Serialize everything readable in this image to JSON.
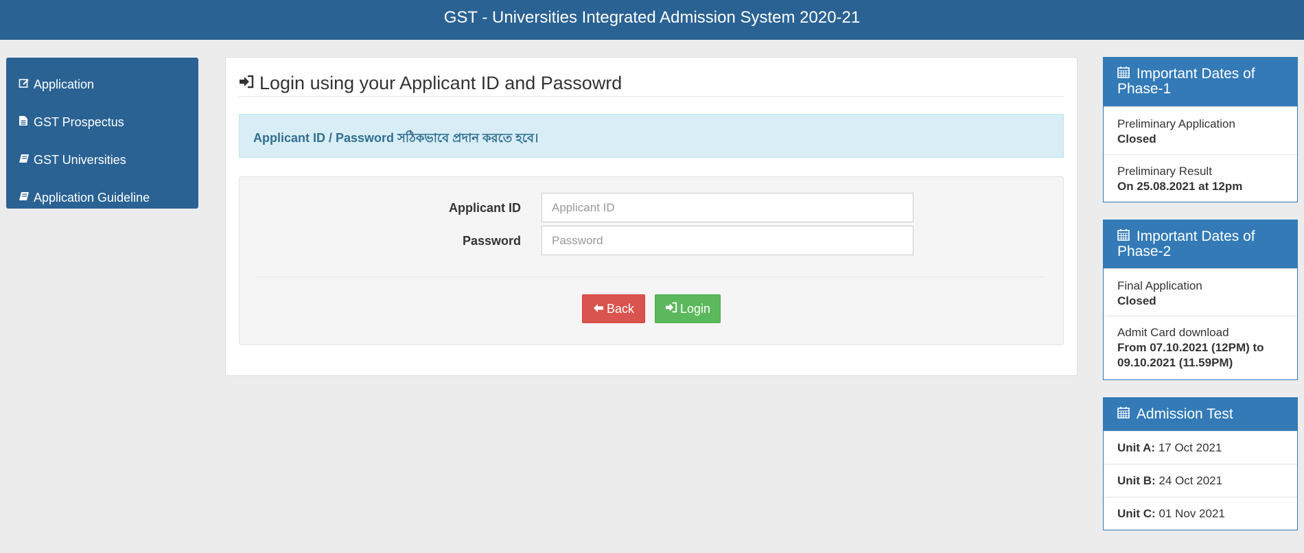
{
  "header": {
    "title": "GST - Universities Integrated Admission System 2020-21"
  },
  "sidebar": {
    "items": [
      {
        "icon": "edit-icon",
        "label": "Application"
      },
      {
        "icon": "file-icon",
        "label": "GST Prospectus"
      },
      {
        "icon": "book-icon",
        "label": "GST Universities"
      },
      {
        "icon": "book-icon",
        "label": "Application Guideline"
      }
    ]
  },
  "login": {
    "title": "Login using your Applicant ID and Passowrd",
    "alert": "Applicant ID / Password সঠিকভাবে প্রদান করতে হবে।",
    "applicant_id_label": "Applicant ID",
    "applicant_id_placeholder": "Applicant ID",
    "password_label": "Password",
    "password_placeholder": "Password",
    "back_label": "Back",
    "login_label": "Login"
  },
  "phase1": {
    "title": "Important Dates of Phase-1",
    "rows": [
      {
        "label": "Preliminary Application",
        "value": "Closed"
      },
      {
        "label": "Preliminary Result",
        "value": "On 25.08.2021 at 12pm"
      }
    ]
  },
  "phase2": {
    "title": "Important Dates of Phase-2",
    "rows": [
      {
        "label": "Final Application",
        "value": "Closed"
      },
      {
        "label": "Admit Card download",
        "value": "From 07.10.2021 (12PM) to 09.10.2021 (11.59PM)"
      }
    ]
  },
  "admission_test": {
    "title": "Admission Test",
    "rows": [
      {
        "unit": "Unit A:",
        "date": "17 Oct 2021"
      },
      {
        "unit": "Unit B:",
        "date": "24 Oct 2021"
      },
      {
        "unit": "Unit C:",
        "date": "01 Nov 2021"
      }
    ]
  }
}
